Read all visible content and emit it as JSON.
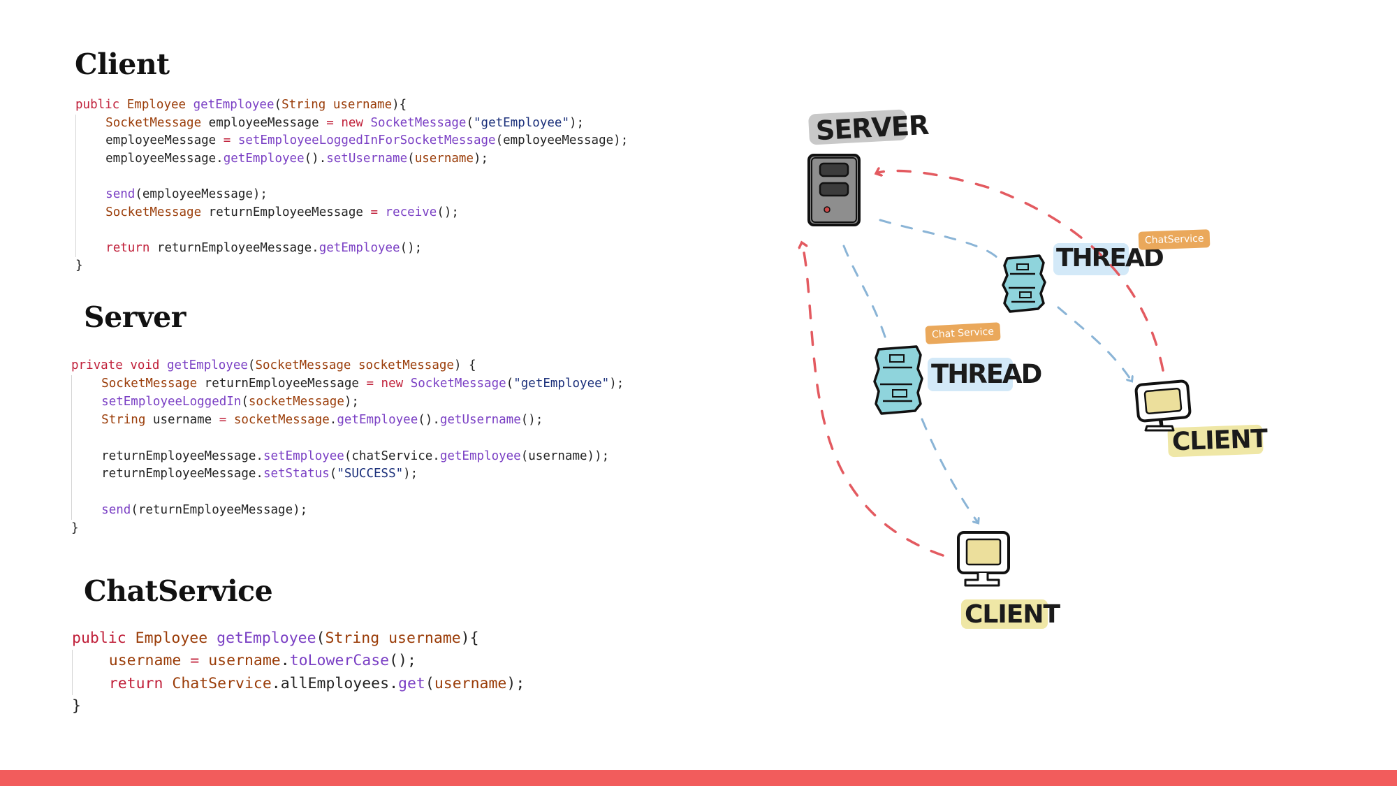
{
  "sections": {
    "client": {
      "title": "Client",
      "code": [
        [
          [
            "kw",
            "public"
          ],
          [
            "id",
            " "
          ],
          [
            "ty",
            "Employee"
          ],
          [
            "id",
            " "
          ],
          [
            "fn",
            "getEmployee"
          ],
          [
            "id",
            "("
          ],
          [
            "ty",
            "String"
          ],
          [
            "id",
            " "
          ],
          [
            "pa",
            "username"
          ],
          [
            "id",
            "){"
          ]
        ],
        [
          [
            "id",
            "    "
          ],
          [
            "ty",
            "SocketMessage"
          ],
          [
            "id",
            " employeeMessage "
          ],
          [
            "op",
            "="
          ],
          [
            "id",
            " "
          ],
          [
            "kw",
            "new"
          ],
          [
            "id",
            " "
          ],
          [
            "fn",
            "SocketMessage"
          ],
          [
            "id",
            "("
          ],
          [
            "st",
            "\"getEmployee\""
          ],
          [
            "id",
            ");"
          ]
        ],
        [
          [
            "id",
            "    employeeMessage "
          ],
          [
            "op",
            "="
          ],
          [
            "id",
            " "
          ],
          [
            "fn",
            "setEmployeeLoggedInForSocketMessage"
          ],
          [
            "id",
            "(employeeMessage);"
          ]
        ],
        [
          [
            "id",
            "    employeeMessage."
          ],
          [
            "fn",
            "getEmployee"
          ],
          [
            "id",
            "()."
          ],
          [
            "fn",
            "setUsername"
          ],
          [
            "id",
            "("
          ],
          [
            "pa",
            "username"
          ],
          [
            "id",
            ");"
          ]
        ],
        [
          [
            "id",
            ""
          ]
        ],
        [
          [
            "id",
            "    "
          ],
          [
            "fn",
            "send"
          ],
          [
            "id",
            "(employeeMessage);"
          ]
        ],
        [
          [
            "id",
            "    "
          ],
          [
            "ty",
            "SocketMessage"
          ],
          [
            "id",
            " returnEmployeeMessage "
          ],
          [
            "op",
            "="
          ],
          [
            "id",
            " "
          ],
          [
            "fn",
            "receive"
          ],
          [
            "id",
            "();"
          ]
        ],
        [
          [
            "id",
            ""
          ]
        ],
        [
          [
            "id",
            "    "
          ],
          [
            "kw",
            "return"
          ],
          [
            "id",
            " returnEmployeeMessage."
          ],
          [
            "fn",
            "getEmployee"
          ],
          [
            "id",
            "();"
          ]
        ],
        [
          [
            "id",
            "}"
          ]
        ]
      ]
    },
    "server": {
      "title": "Server",
      "code": [
        [
          [
            "kw",
            "private"
          ],
          [
            "id",
            " "
          ],
          [
            "kw",
            "void"
          ],
          [
            "id",
            " "
          ],
          [
            "fn",
            "getEmployee"
          ],
          [
            "id",
            "("
          ],
          [
            "ty",
            "SocketMessage"
          ],
          [
            "id",
            " "
          ],
          [
            "pa",
            "socketMessage"
          ],
          [
            "id",
            ") {"
          ]
        ],
        [
          [
            "id",
            "    "
          ],
          [
            "ty",
            "SocketMessage"
          ],
          [
            "id",
            " returnEmployeeMessage "
          ],
          [
            "op",
            "="
          ],
          [
            "id",
            " "
          ],
          [
            "kw",
            "new"
          ],
          [
            "id",
            " "
          ],
          [
            "fn",
            "SocketMessage"
          ],
          [
            "id",
            "("
          ],
          [
            "st",
            "\"getEmployee\""
          ],
          [
            "id",
            ");"
          ]
        ],
        [
          [
            "id",
            "    "
          ],
          [
            "fn",
            "setEmployeeLoggedIn"
          ],
          [
            "id",
            "("
          ],
          [
            "pa",
            "socketMessage"
          ],
          [
            "id",
            ");"
          ]
        ],
        [
          [
            "id",
            "    "
          ],
          [
            "ty",
            "String"
          ],
          [
            "id",
            " username "
          ],
          [
            "op",
            "="
          ],
          [
            "id",
            " "
          ],
          [
            "pa",
            "socketMessage"
          ],
          [
            "id",
            "."
          ],
          [
            "fn",
            "getEmployee"
          ],
          [
            "id",
            "()."
          ],
          [
            "fn",
            "getUsername"
          ],
          [
            "id",
            "();"
          ]
        ],
        [
          [
            "id",
            ""
          ]
        ],
        [
          [
            "id",
            "    returnEmployeeMessage."
          ],
          [
            "fn",
            "setEmployee"
          ],
          [
            "id",
            "(chatService."
          ],
          [
            "fn",
            "getEmployee"
          ],
          [
            "id",
            "(username));"
          ]
        ],
        [
          [
            "id",
            "    returnEmployeeMessage."
          ],
          [
            "fn",
            "setStatus"
          ],
          [
            "id",
            "("
          ],
          [
            "st",
            "\"SUCCESS\""
          ],
          [
            "id",
            ");"
          ]
        ],
        [
          [
            "id",
            ""
          ]
        ],
        [
          [
            "id",
            "    "
          ],
          [
            "fn",
            "send"
          ],
          [
            "id",
            "(returnEmployeeMessage);"
          ]
        ],
        [
          [
            "id",
            "}"
          ]
        ]
      ]
    },
    "chatservice": {
      "title": "ChatService",
      "code": [
        [
          [
            "kw",
            "public"
          ],
          [
            "id",
            " "
          ],
          [
            "ty",
            "Employee"
          ],
          [
            "id",
            " "
          ],
          [
            "fn",
            "getEmployee"
          ],
          [
            "id",
            "("
          ],
          [
            "ty",
            "String"
          ],
          [
            "id",
            " "
          ],
          [
            "pa",
            "username"
          ],
          [
            "id",
            "){"
          ]
        ],
        [
          [
            "id",
            "    "
          ],
          [
            "pa",
            "username"
          ],
          [
            "id",
            " "
          ],
          [
            "op",
            "="
          ],
          [
            "id",
            " "
          ],
          [
            "pa",
            "username"
          ],
          [
            "id",
            "."
          ],
          [
            "fn",
            "toLowerCase"
          ],
          [
            "id",
            "();"
          ]
        ],
        [
          [
            "id",
            "    "
          ],
          [
            "kw",
            "return"
          ],
          [
            "id",
            " "
          ],
          [
            "ty",
            "ChatService"
          ],
          [
            "id",
            ".allEmployees."
          ],
          [
            "fn",
            "get"
          ],
          [
            "id",
            "("
          ],
          [
            "pa",
            "username"
          ],
          [
            "id",
            ");"
          ]
        ],
        [
          [
            "id",
            "}"
          ]
        ]
      ]
    }
  },
  "diagram": {
    "server_label": "SERVER",
    "thread_label_1": "THREAD",
    "thread_label_2": "THREAD",
    "client_label_1": "CLIENT",
    "client_label_2": "CLIENT",
    "chatservice_badge_1": "ChatService",
    "chatservice_badge_2": "Chat Service",
    "colors": {
      "request_arrow": "#8ab4d6",
      "response_arrow": "#e35a60",
      "server_label_bg": "#c8c8c8",
      "thread_label_bg": "#d3e9f8",
      "client_label_bg": "#efe7a6",
      "badge_bg": "#eaa85b",
      "thread_icon": "#8fd4dc",
      "monitor_screen": "#ecdf9c",
      "footer": "#f25c5c"
    },
    "icons": [
      "server-tower-icon",
      "thread-stack-icon",
      "thread-stack-icon",
      "monitor-icon",
      "monitor-icon"
    ]
  }
}
